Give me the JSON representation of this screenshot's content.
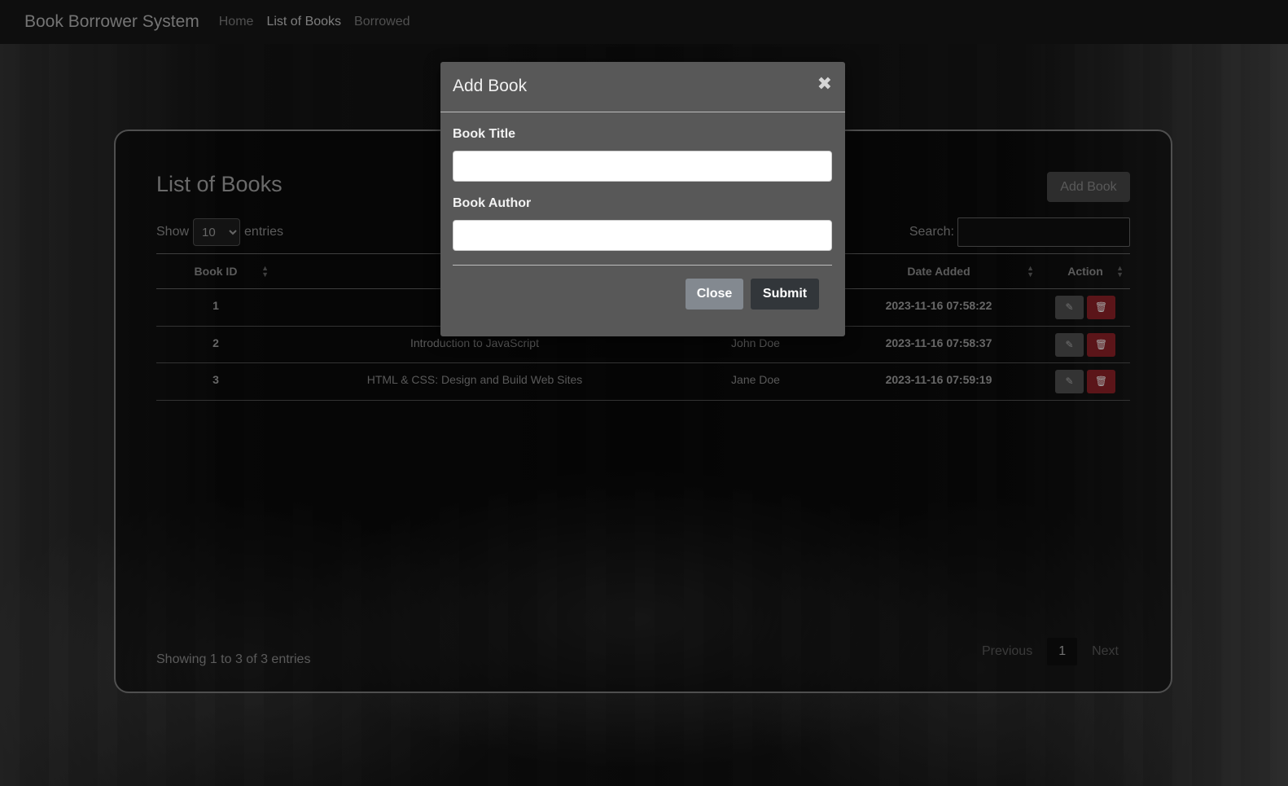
{
  "navbar": {
    "brand": "Book Borrower System",
    "links": [
      {
        "label": "Home",
        "active": false
      },
      {
        "label": "List of Books",
        "active": true
      },
      {
        "label": "Borrowed",
        "active": false
      }
    ]
  },
  "card": {
    "title": "List of Books",
    "add_button": "Add Book",
    "show_label": "Show",
    "entries_value": "10",
    "entries_label": "entries",
    "search_label": "Search:",
    "columns": [
      "Book ID",
      "",
      "",
      "Date Added",
      "Action"
    ],
    "rows": [
      {
        "id": "1",
        "title": "",
        "author": "",
        "date": "2023-11-16 07:58:22"
      },
      {
        "id": "2",
        "title": "Introduction to JavaScript",
        "author": "John Doe",
        "date": "2023-11-16 07:58:37"
      },
      {
        "id": "3",
        "title": "HTML & CSS: Design and Build Web Sites",
        "author": "Jane Doe",
        "date": "2023-11-16 07:59:19"
      }
    ],
    "info": "Showing 1 to 3 of 3 entries",
    "pager": {
      "previous": "Previous",
      "current": "1",
      "next": "Next"
    }
  },
  "modal": {
    "title": "Add Book",
    "close_glyph": "✖",
    "fields": [
      {
        "label": "Book Title",
        "value": ""
      },
      {
        "label": "Book Author",
        "value": ""
      }
    ],
    "close_button": "Close",
    "submit_button": "Submit"
  },
  "icons": {
    "edit": "pencil-icon",
    "delete": "trash-icon"
  },
  "colors": {
    "delete_button": "#7a1c22",
    "submit_button": "#32363a",
    "close_button": "#838990"
  }
}
